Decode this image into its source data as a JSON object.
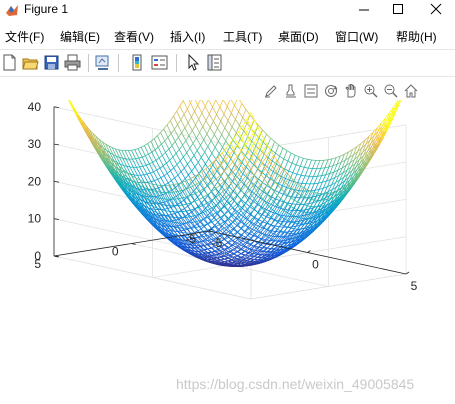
{
  "window": {
    "title": "Figure 1",
    "controls": [
      "minimize",
      "maximize",
      "close"
    ]
  },
  "menu": [
    {
      "label": "文件(F)"
    },
    {
      "label": "编辑(E)"
    },
    {
      "label": "查看(V)"
    },
    {
      "label": "插入(I)"
    },
    {
      "label": "工具(T)"
    },
    {
      "label": "桌面(D)"
    },
    {
      "label": "窗口(W)"
    },
    {
      "label": "帮助(H)"
    }
  ],
  "toolbar": [
    "new-figure-icon",
    "open-file-icon",
    "save-icon",
    "print-icon",
    "link-plot-icon",
    "insert-colorbar-icon",
    "insert-legend-icon",
    "edit-plot-arrow-icon",
    "property-inspector-icon"
  ],
  "axes_toolbar": [
    "brush-icon",
    "data-tips-icon",
    "legend-toggle-icon",
    "rotate-3d-icon",
    "pan-hand-icon",
    "zoom-in-icon",
    "zoom-out-icon",
    "home-icon"
  ],
  "chart_data": {
    "type": "surface-mesh",
    "function": "z = x^2 + y^2",
    "xlim": [
      -5,
      5
    ],
    "ylim": [
      -5,
      5
    ],
    "zlim": [
      0,
      40
    ],
    "x_ticks": [
      -5,
      0,
      5
    ],
    "y_ticks": [
      -5,
      0,
      5
    ],
    "z_ticks": [
      0,
      10,
      20,
      30,
      40
    ],
    "colormap": "parula",
    "grid": true
  },
  "watermark": "https://blog.csdn.net/weixin_49005845"
}
